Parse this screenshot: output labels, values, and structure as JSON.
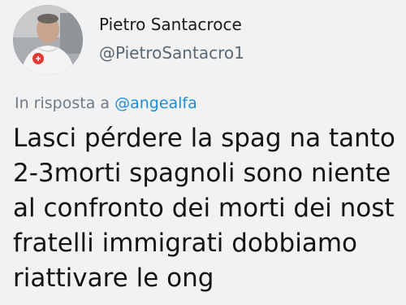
{
  "author": {
    "display_name": "Pietro Santacroce",
    "handle": "@PietroSantacro1",
    "avatar_icon": "profile-photo-icon"
  },
  "reply": {
    "prefix": "In risposta a ",
    "mention": "@angealfa",
    "mention_color": "#1b8fd6"
  },
  "tweet": {
    "lines": [
      "Lasci pérdere la spag na tanto",
      "2-3morti spagnoli sono niente",
      "al confronto dei morti dei nost",
      "fratelli immigrati dobbiamo",
      "riattivare le ong"
    ]
  }
}
